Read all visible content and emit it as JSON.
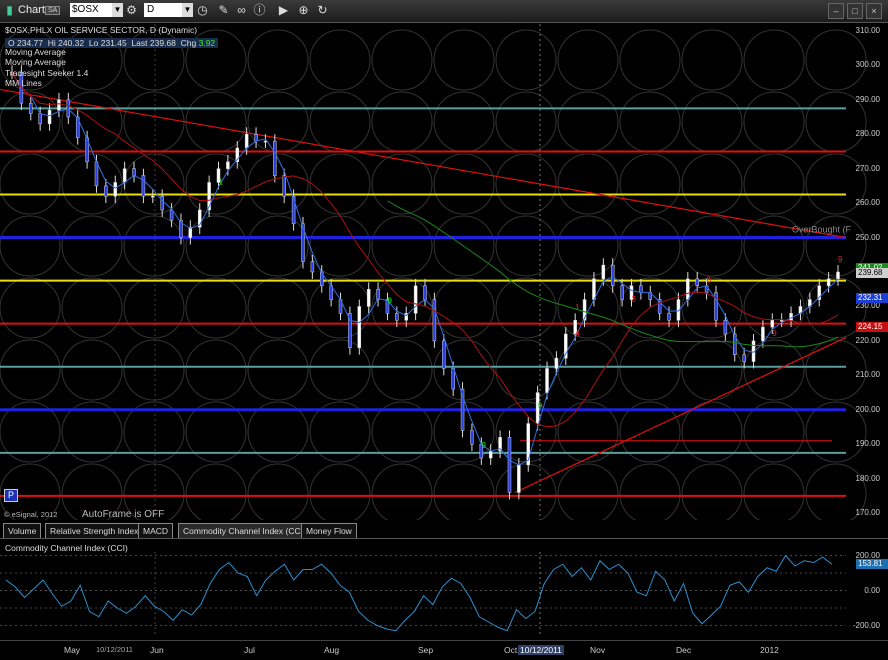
{
  "window": {
    "app_name": "Chart",
    "app_badge": "SA",
    "symbol": "$OSX",
    "interval": "D"
  },
  "chart": {
    "title": "$OSX,PHLX OIL SERVICE SECTOR, D (Dynamic)",
    "ohlc": {
      "o_label": "O",
      "o": "234.77",
      "h_label": "Hi",
      "h": "240.32",
      "l_label": "Lo",
      "l": "231.45",
      "last_label": "Last",
      "last": "239.68",
      "chg_label": "Chg",
      "chg": "3.92"
    },
    "studies": [
      "Moving Average",
      "Moving Average",
      "Tradesight Seeker 1.4",
      "MM Lines"
    ],
    "overbought_label": "OverBought (F",
    "price_axis": [
      "310.00",
      "300.00",
      "290.00",
      "280.00",
      "270.00",
      "260.00",
      "250.00",
      "240.00",
      "230.00",
      "220.00",
      "210.00",
      "200.00",
      "190.00",
      "180.00",
      "170.00"
    ],
    "price_badges": [
      {
        "text": "241.02",
        "color": "#1d8a1d"
      },
      {
        "text": "239.68",
        "color": "#cfcfcf"
      },
      {
        "text": "232.31",
        "color": "#1d3fd0"
      },
      {
        "text": "224.15",
        "color": "#c41010"
      }
    ],
    "copyright": "© eSignal, 2012",
    "autoframe": "AutoFrame is OFF",
    "p_button": "P"
  },
  "tabs": [
    "Volume",
    "Relative Strength Index",
    "MACD",
    "Commodity Channel Index (CCI)",
    "Money Flow"
  ],
  "active_tab": 3,
  "cci": {
    "title": "Commodity Channel Index (CCI)",
    "axis": [
      "200.00",
      "0.00",
      "-200.00"
    ],
    "current": "153.81"
  },
  "x_axis": [
    "May",
    "10/12/2011",
    "Jun",
    "Jul",
    "Aug",
    "Sep",
    "Oct",
    "10/12/2011",
    "Nov",
    "Dec",
    "2012"
  ],
  "colors": {
    "red_line": "#e01010",
    "yellow_line": "#e8e000",
    "blue_line": "#2020e0",
    "teal_line": "#5a9e9e",
    "up_candle": "#ffffff",
    "down_candle": "#2a40e0",
    "ma_red": "#b01010",
    "ma_green": "#1a8a1a",
    "ma_blue": "#3070e0",
    "cci_line": "#2a90d0"
  },
  "chart_data": [
    {
      "type": "line",
      "title": "$OSX,PHLX OIL SERVICE SECTOR, D (Dynamic)",
      "x_ticks": [
        "May",
        "Jun",
        "Jul",
        "Aug",
        "Sep",
        "Oct",
        "Nov",
        "Dec",
        "2012"
      ],
      "ylim": [
        168,
        312
      ],
      "series": [
        {
          "name": "",
          "values": [
            298,
            289,
            286,
            283,
            287,
            290,
            285,
            279,
            272,
            265,
            262,
            266,
            270,
            268,
            262,
            262,
            258,
            255,
            250,
            253,
            258,
            266,
            270,
            272,
            276,
            280,
            278,
            278,
            268,
            262,
            254,
            243,
            240,
            236,
            232,
            228,
            218,
            230,
            235,
            232,
            228,
            226,
            228,
            236,
            232,
            220,
            212,
            206,
            194,
            190,
            186,
            188,
            192,
            176,
            184,
            196,
            205,
            212,
            215,
            222,
            226,
            232,
            238,
            242,
            236,
            232,
            236,
            234,
            232,
            228,
            226,
            232,
            238,
            236,
            234,
            226,
            222,
            216,
            214,
            220,
            224,
            226,
            226,
            228,
            230,
            232,
            236,
            238,
            240
          ]
        }
      ],
      "horizontal_levels": [
        287.5,
        275,
        262.5,
        250,
        237.5,
        225,
        212.5,
        200,
        187.5,
        175
      ]
    },
    {
      "type": "line",
      "title": "Commodity Channel Index (CCI)",
      "ylim": [
        -260,
        220
      ],
      "series": [
        {
          "name": "",
          "values": [
            60,
            20,
            -40,
            10,
            60,
            -20,
            -90,
            -60,
            30,
            -120,
            -150,
            -60,
            -100,
            -130,
            -90,
            -30,
            -90,
            -120,
            -170,
            -110,
            -140,
            -80,
            40,
            120,
            160,
            100,
            80,
            -30,
            60,
            110,
            150,
            60,
            120,
            120,
            150,
            100,
            30,
            -10,
            -120,
            -170,
            -200,
            -220,
            -230,
            -170,
            -120,
            -30,
            -80,
            20,
            70,
            40,
            -40,
            -150,
            -180,
            -210,
            -230,
            -110,
            -160,
            -120,
            40,
            120,
            150,
            80,
            130,
            60,
            170,
            120,
            150,
            100,
            -10,
            -30,
            110,
            60,
            -60,
            40,
            -130,
            -190,
            -140,
            -90,
            30,
            50,
            -10,
            80,
            130,
            110,
            200,
            140,
            170,
            160,
            190,
            150
          ]
        }
      ]
    }
  ]
}
